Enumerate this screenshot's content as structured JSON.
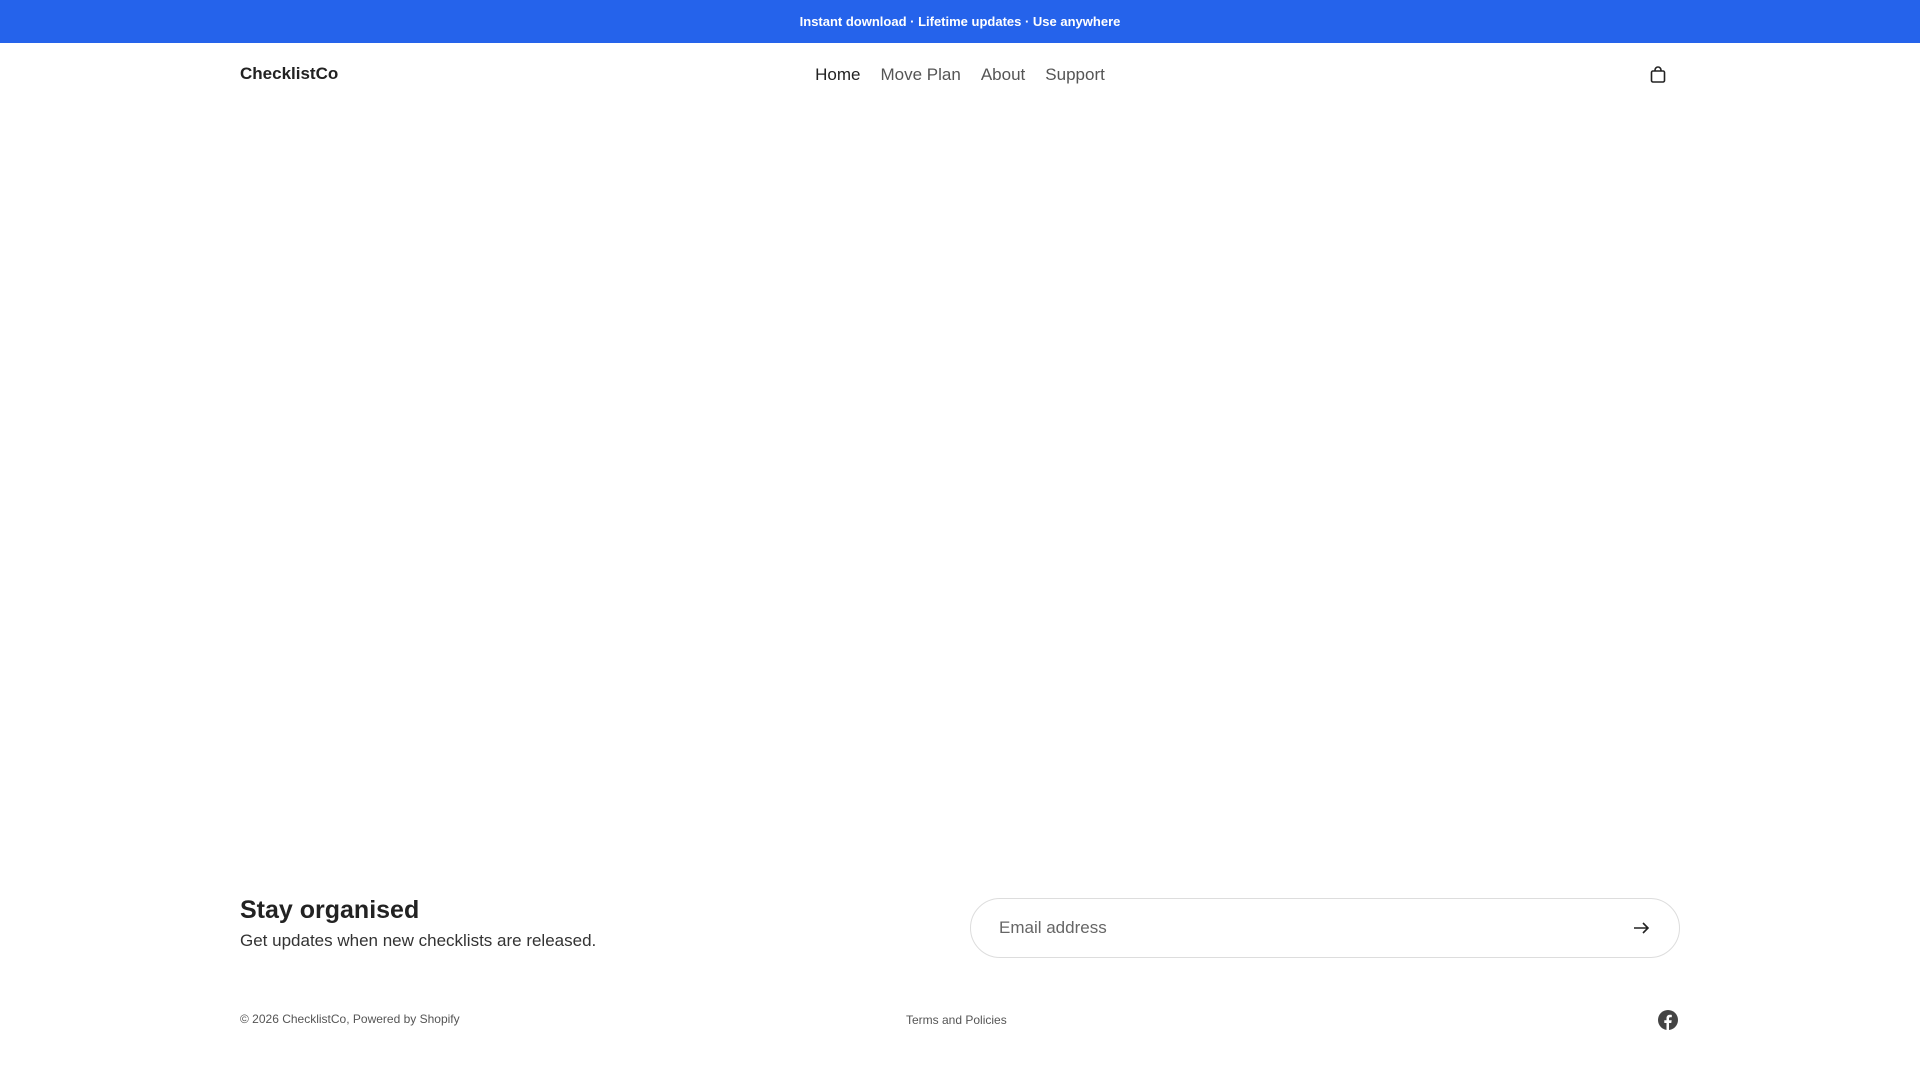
{
  "announcement": "Instant download · Lifetime updates · Use anywhere",
  "header": {
    "logo": "ChecklistCo",
    "nav": [
      "Home",
      "Move Plan",
      "About",
      "Support"
    ],
    "cart_icon": "shopping-bag-icon"
  },
  "newsletter": {
    "title": "Stay organised",
    "subtitle": "Get updates when new checklists are released.",
    "email_placeholder": "Email address",
    "submit_icon": "arrow-right-icon"
  },
  "footer": {
    "copyright": "© 2026 ChecklistCo, Powered by Shopify",
    "terms": "Terms and Policies",
    "social_icon": "facebook-icon"
  },
  "colors": {
    "accent": "#2563eb"
  }
}
